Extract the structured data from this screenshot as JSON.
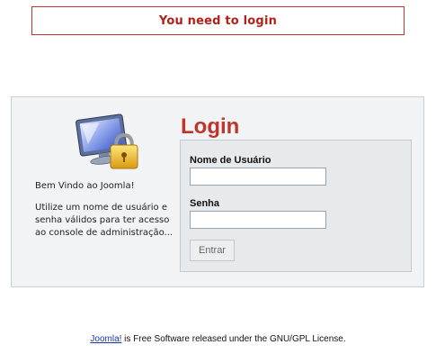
{
  "alert": {
    "message": "You need to login"
  },
  "panel": {
    "icon": "monitor-with-padlock-icon",
    "welcome_title": "Bem Vindo ao Joomla!",
    "welcome_text": "Utilize um nome de usuário e senha válidos para ter acesso ao console de administração...",
    "login_title": "Login",
    "form": {
      "username_label": "Nome de Usuário",
      "username_value": "",
      "password_label": "Senha",
      "password_value": "",
      "submit_label": "Entrar"
    }
  },
  "footer": {
    "link_text": "Joomla!",
    "text": " is Free Software released under the GNU/GPL License."
  },
  "colors": {
    "alert_text": "#b12019",
    "alert_border": "#c3332c",
    "login_title": "#c0352b",
    "panel_bg": "#f1f3f5",
    "link": "#1a37a8"
  }
}
